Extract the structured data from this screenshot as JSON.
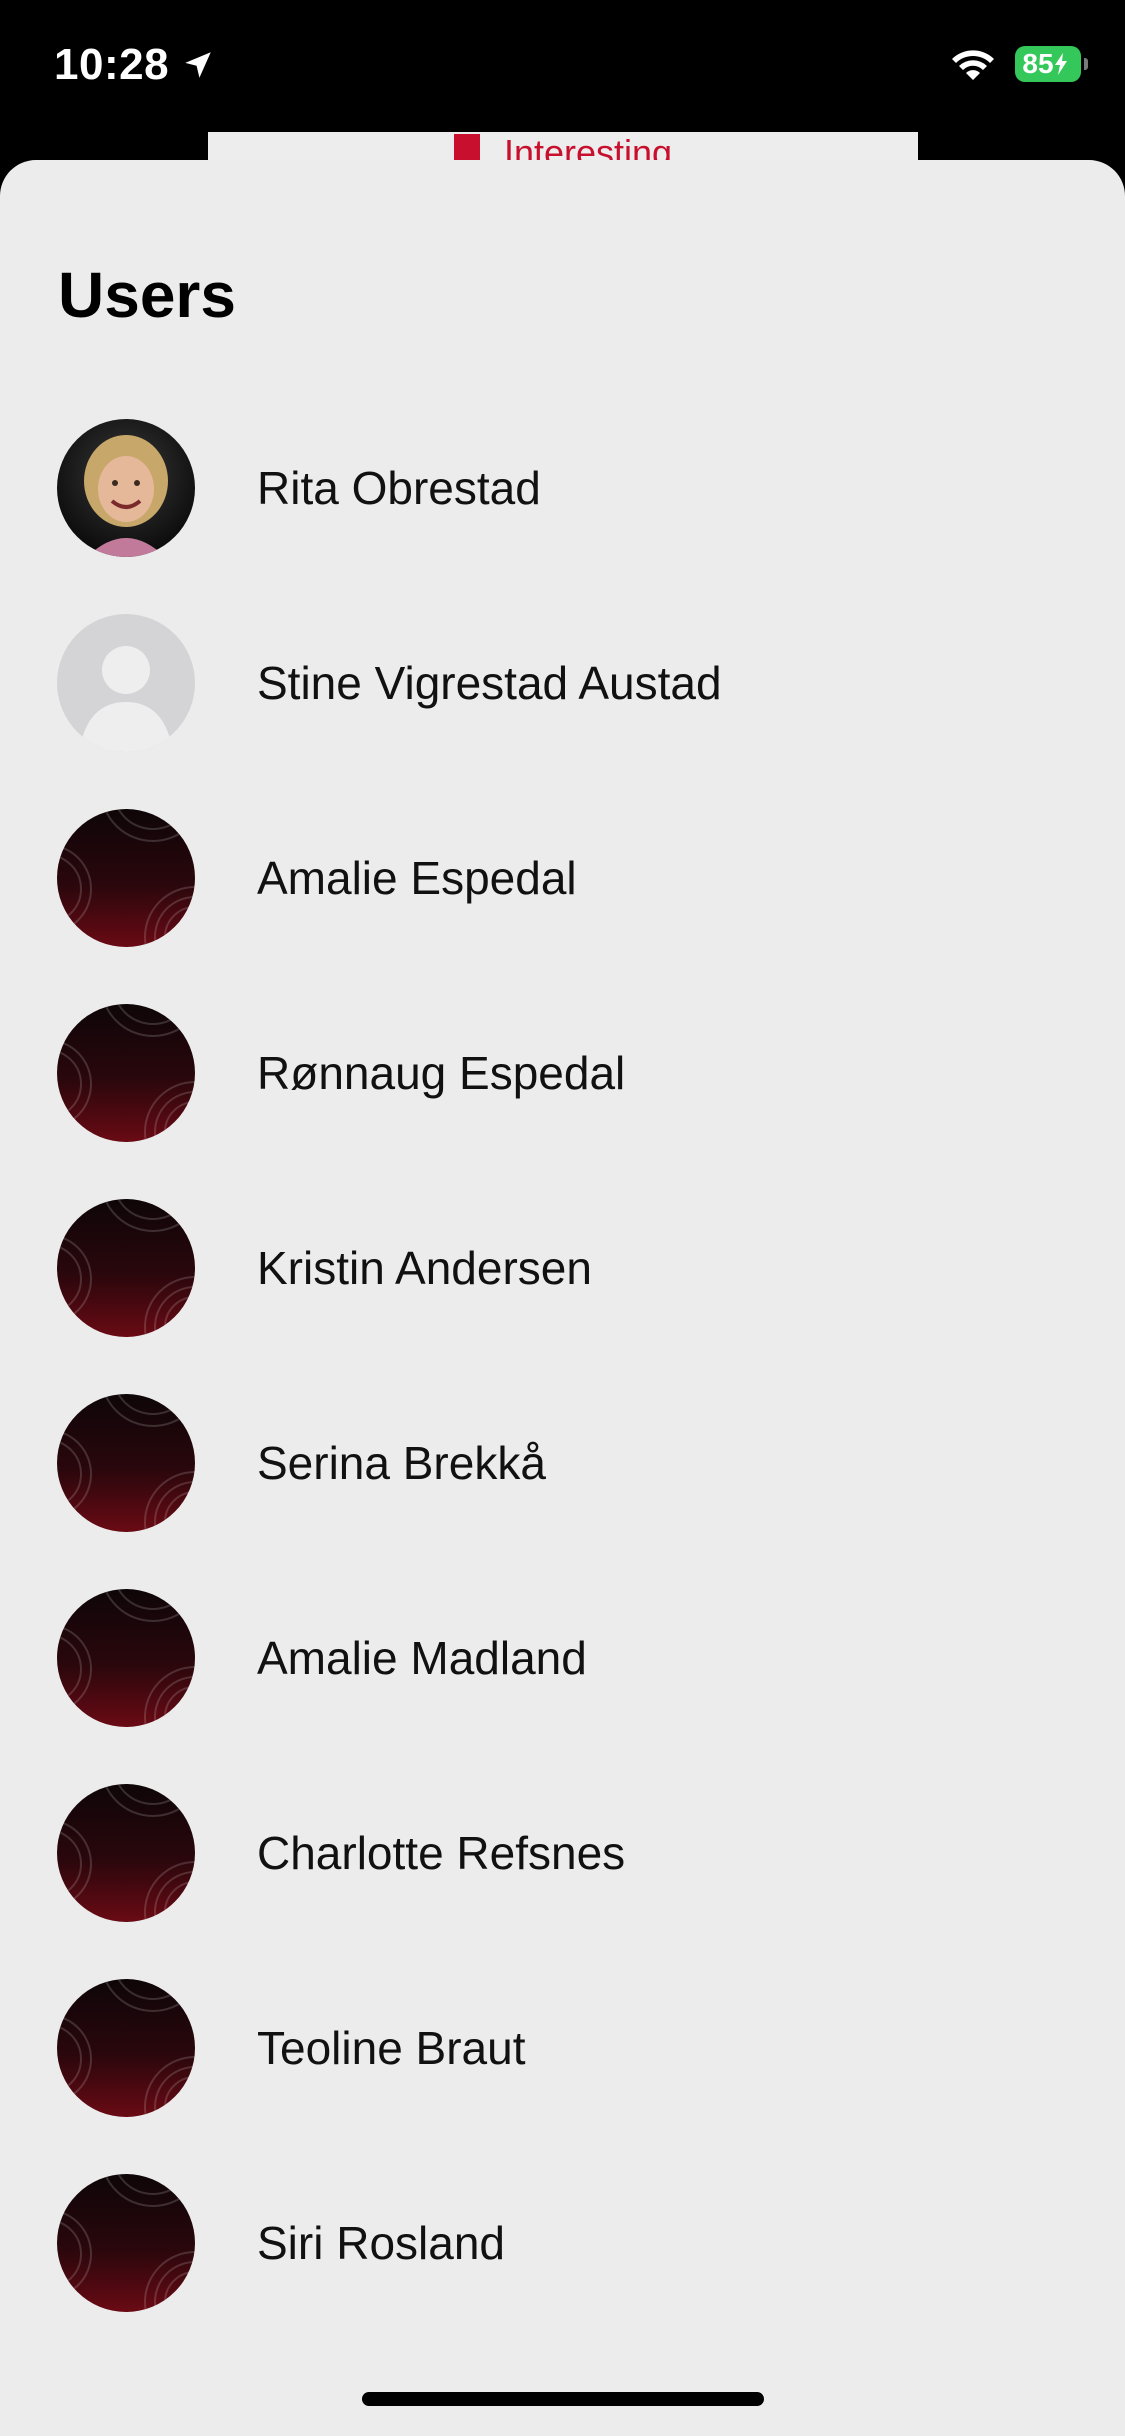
{
  "status_bar": {
    "time": "10:28",
    "battery_level": "85",
    "icons": [
      "location-arrow-icon",
      "wifi-icon",
      "battery-charging-icon"
    ]
  },
  "background_page": {
    "label": "Interesting",
    "icon": "bookmark-icon"
  },
  "sheet": {
    "title": "Users",
    "users": [
      {
        "name": "Rita Obrestad",
        "avatar": "photo"
      },
      {
        "name": "Stine Vigrestad Austad",
        "avatar": "placeholder"
      },
      {
        "name": "Amalie Espedal",
        "avatar": "default"
      },
      {
        "name": "Rønnaug Espedal",
        "avatar": "default"
      },
      {
        "name": "Kristin Andersen",
        "avatar": "default"
      },
      {
        "name": "Serina Brekkå",
        "avatar": "default"
      },
      {
        "name": "Amalie Madland",
        "avatar": "default"
      },
      {
        "name": "Charlotte Refsnes",
        "avatar": "default"
      },
      {
        "name": "Teoline Braut",
        "avatar": "default"
      },
      {
        "name": "Siri Rosland",
        "avatar": "default"
      }
    ]
  },
  "colors": {
    "accent": "#c8102e",
    "sheet_background": "#ececec",
    "battery": "#34c759"
  }
}
